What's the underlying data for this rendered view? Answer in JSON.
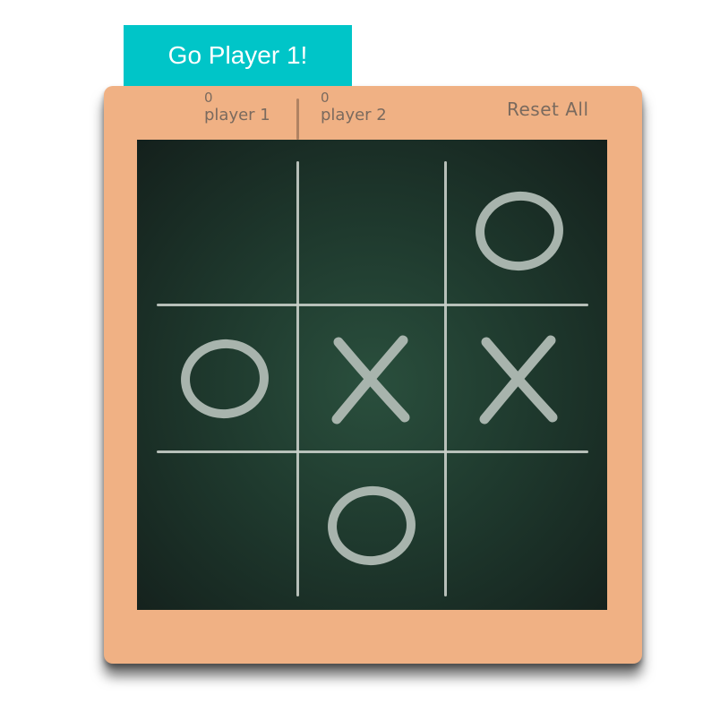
{
  "turn_banner": {
    "text": "Go Player 1!"
  },
  "scoreboard": {
    "player1": {
      "score": "0",
      "label": "player 1"
    },
    "player2": {
      "score": "0",
      "label": "player 2"
    },
    "reset_label": "Reset All"
  },
  "board": {
    "cells": [
      "",
      "",
      "O",
      "O",
      "X",
      "X",
      "",
      "O",
      ""
    ],
    "chalk_color": "#a8b4ad"
  },
  "colors": {
    "banner": "#00c5c8",
    "frame": "#f0b184",
    "chalkboard": "#1f3a2e"
  }
}
